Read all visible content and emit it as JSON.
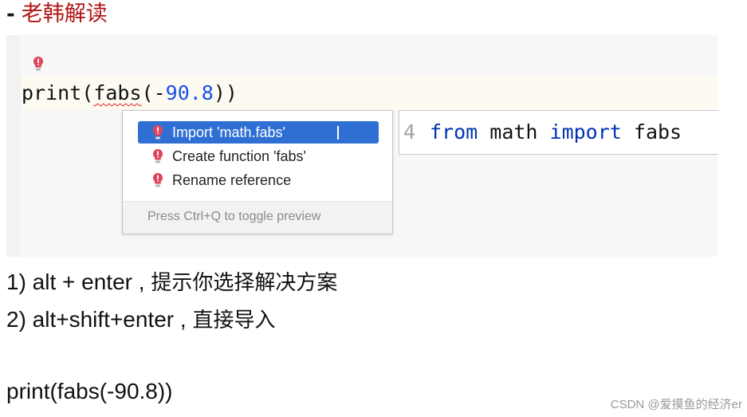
{
  "header": {
    "dash": "-",
    "title": "老韩解读"
  },
  "editor": {
    "code": {
      "func": "print(",
      "error_token": "fabs",
      "open": "(-",
      "number": "90.8",
      "close": "))"
    }
  },
  "popup": {
    "items": [
      {
        "label": "Import 'math.fabs'",
        "selected": true
      },
      {
        "label": "Create function 'fabs'",
        "selected": false
      },
      {
        "label": "Rename reference",
        "selected": false
      }
    ],
    "footer_hint": "Press Ctrl+Q to toggle preview"
  },
  "preview": {
    "line_number": "4",
    "kw_from": "from",
    "module": " math ",
    "kw_import": "import",
    "name": " fabs"
  },
  "notes": [
    {
      "latin": "1) alt + enter , ",
      "cn": "提示你选择解决方案"
    },
    {
      "latin": "2) alt+shift+enter , ",
      "cn": "直接导入"
    }
  ],
  "example_code": "print(fabs(-90.8))",
  "watermark": "CSDN @爱摸鱼的经济er",
  "colors": {
    "title_red": "#b21616",
    "selection_blue": "#2f6fd3",
    "keyword_blue": "#0033b3",
    "number_blue": "#1750eb",
    "warning_red": "#e0435c"
  },
  "icons": {
    "warning": "exclamation-bulb-icon"
  }
}
